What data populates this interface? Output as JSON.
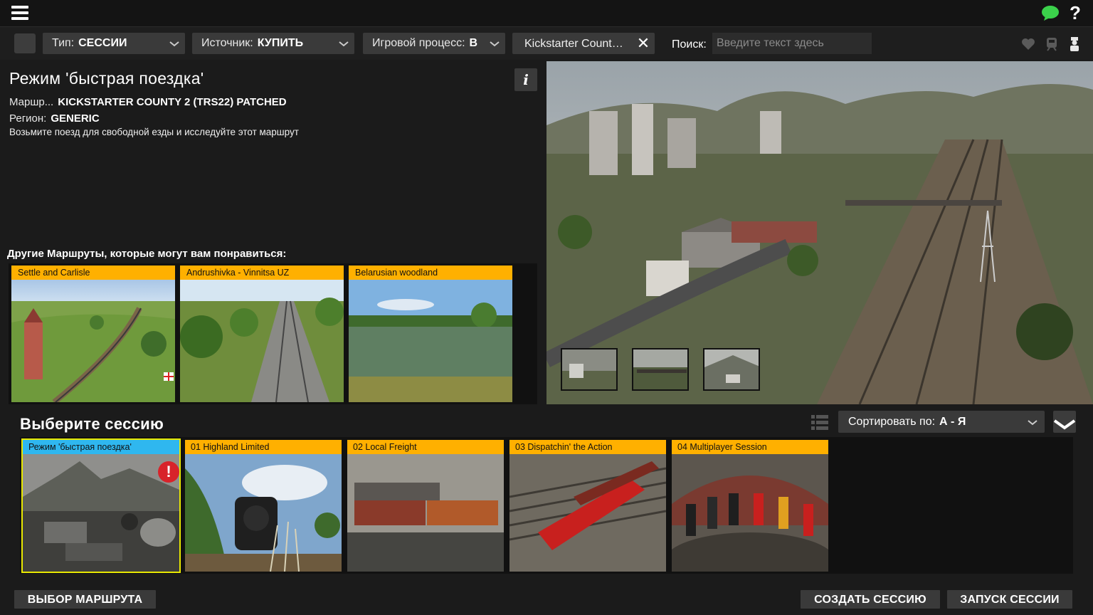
{
  "topbar": {
    "menu_icon": "hamburger-icon",
    "chat_icon": "chat-icon",
    "help_label": "?"
  },
  "filters": {
    "type_label": "Тип:",
    "type_value": "СЕССИИ",
    "source_label": "Источник:",
    "source_value": "КУПИТЬ",
    "gameplay_label": "Игровой процесс:",
    "gameplay_value": "В",
    "chip_text": "Kickstarter Count…",
    "search_label": "Поиск:",
    "search_placeholder": "Введите текст здесь"
  },
  "detail": {
    "title": "Режим 'быстрая поездка'",
    "info_label": "i",
    "route_label": "Маршр...",
    "route_value": "KICKSTARTER COUNTY 2 (TRS22) PATCHED",
    "region_label": "Регион:",
    "region_value": "GENERIC",
    "description": "Возьмите поезд для свободной езды и исследуйте этот маршрут"
  },
  "others": {
    "title": "Другие Маршруты, которые могут вам понравиться:",
    "routes": [
      {
        "label": "Settle and Carlisle"
      },
      {
        "label": "Andrushivka - Vinnitsa UZ"
      },
      {
        "label": "Belarusian woodland"
      }
    ]
  },
  "sessions": {
    "title": "Выберите сессию",
    "sort_label": "Сортировать по:",
    "sort_value": "А - Я",
    "warning_label": "!",
    "items": [
      {
        "label": "Режим 'быстрая поездка'",
        "selected": true
      },
      {
        "label": "01 Highland Limited",
        "selected": false
      },
      {
        "label": "02 Local Freight",
        "selected": false
      },
      {
        "label": "03 Dispatchin' the Action",
        "selected": false
      },
      {
        "label": "04 Multiplayer Session",
        "selected": false
      }
    ]
  },
  "buttons": {
    "choose_route": "ВЫБОР МАРШРУТА",
    "create_session": "СОЗДАТЬ СЕССИЮ",
    "launch_session": "ЗАПУСК СЕССИИ"
  },
  "colors": {
    "card_header": "#ffb000",
    "selected_header": "#2fb7ef",
    "selected_border": "#e8e800",
    "warning": "#d8232a",
    "chat": "#3bd14b"
  }
}
